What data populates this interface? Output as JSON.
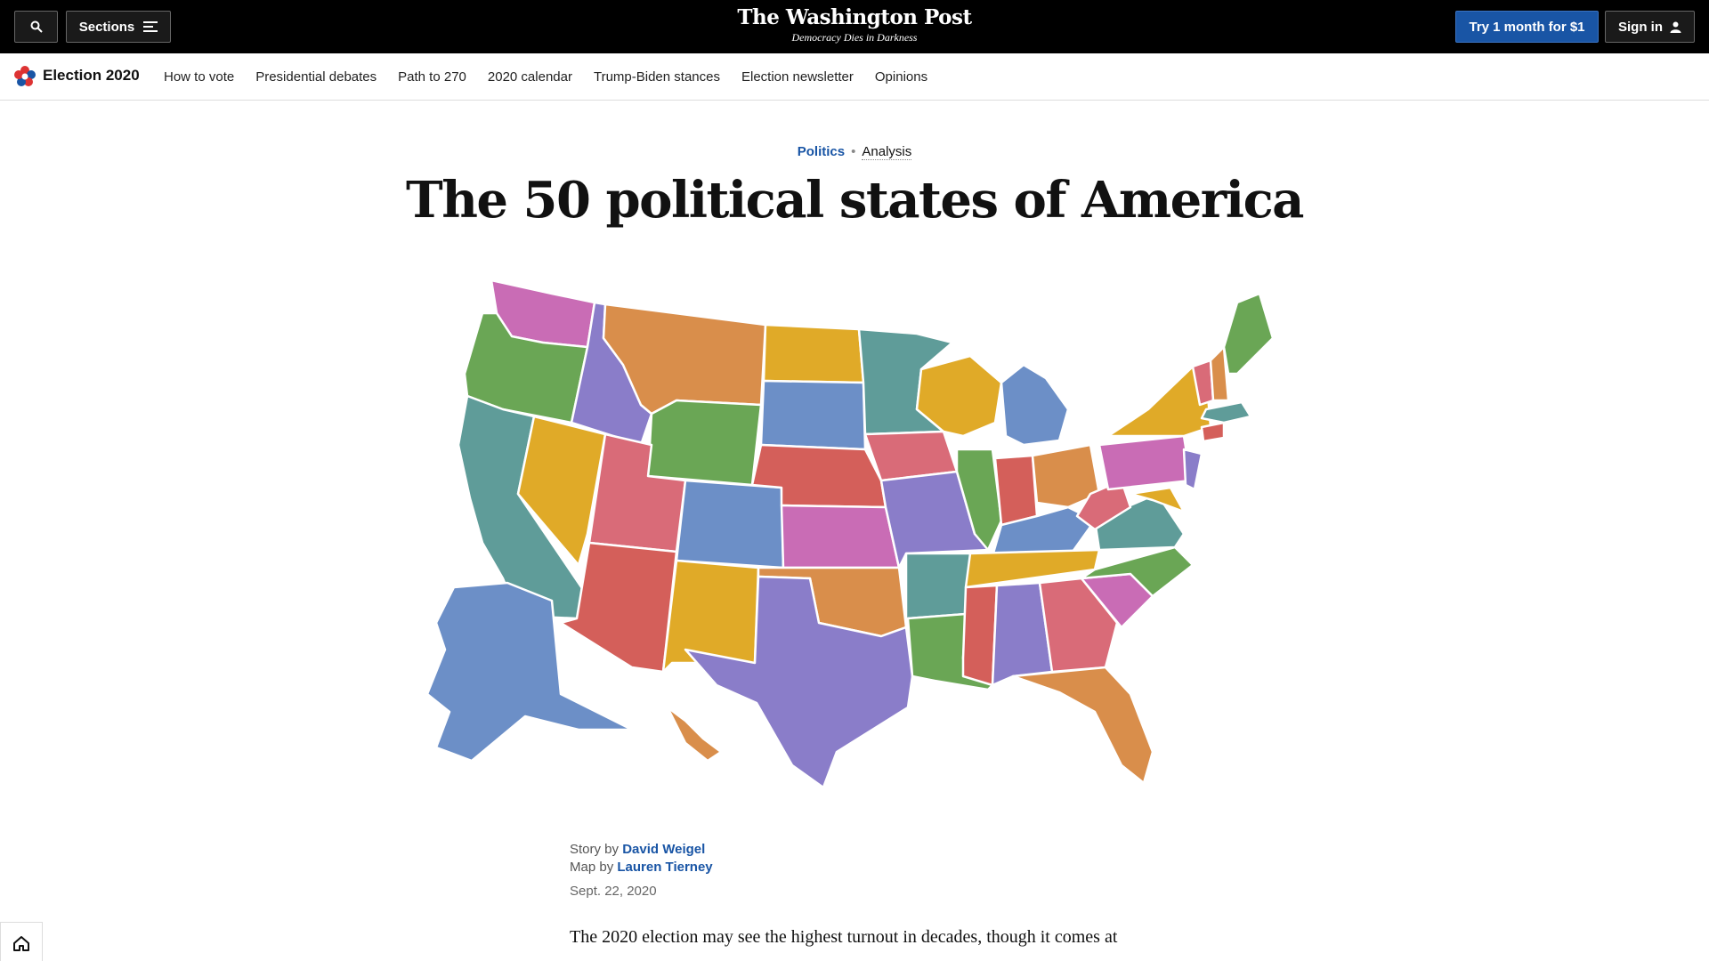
{
  "masthead": {
    "logo": "The Washington Post",
    "tagline": "Democracy Dies in Darkness"
  },
  "topbar": {
    "search_icon": "search-icon",
    "sections_label": "Sections",
    "try_label": "Try 1 month for $1",
    "signin_label": "Sign in"
  },
  "subnav": {
    "title": "Election 2020",
    "links": [
      "How to vote",
      "Presidential debates",
      "Path to 270",
      "2020 calendar",
      "Trump-Biden stances",
      "Election newsletter",
      "Opinions"
    ]
  },
  "article": {
    "section": "Politics",
    "label": "Analysis",
    "headline": "The 50 political states of America",
    "story_prefix": "Story by",
    "story_author": "David Weigel",
    "map_prefix": "Map by",
    "map_author": "Lauren Tierney",
    "date": "Sept. 22, 2020",
    "lede": "The 2020 election may see the highest turnout in decades, though it comes at"
  },
  "colors": {
    "accent": "#1955a5",
    "map_palette": [
      "#c96cb5",
      "#6aa655",
      "#8a7dc9",
      "#d98e4b",
      "#e0aa28",
      "#6c8fc7",
      "#5f9c99",
      "#d96b78",
      "#d45f5a"
    ]
  }
}
